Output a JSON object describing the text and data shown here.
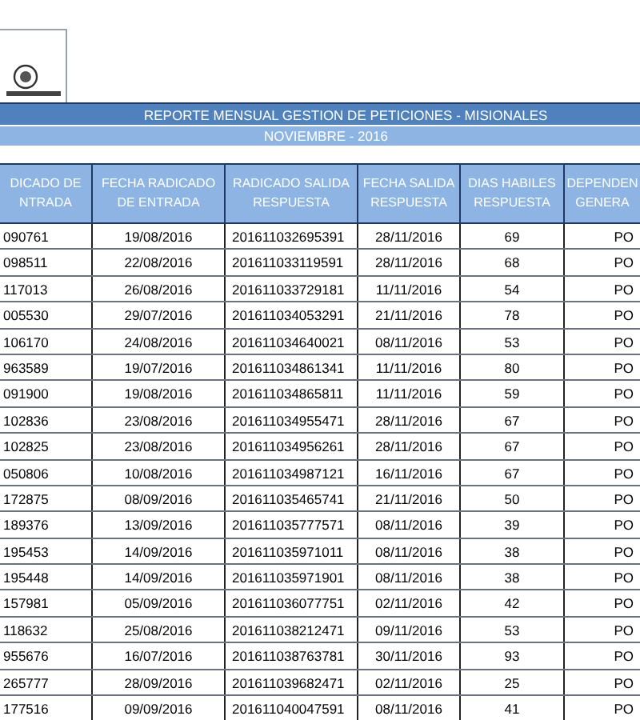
{
  "report": {
    "title": "REPORTE MENSUAL GESTION DE PETICIONES - MISIONALES",
    "period": "NOVIEMBRE - 2016"
  },
  "table": {
    "columns": [
      "DICADO DE NTRADA",
      "FECHA RADICADO DE ENTRADA",
      "RADICADO SALIDA RESPUESTA",
      "FECHA SALIDA RESPUESTA",
      "DIAS HABILES RESPUESTA",
      "DEPENDEN GENERA"
    ],
    "rows": [
      [
        "090761",
        "19/08/2016",
        "201611032695391",
        "28/11/2016",
        "69",
        "PO"
      ],
      [
        "098511",
        "22/08/2016",
        "201611033119591",
        "28/11/2016",
        "68",
        "PO"
      ],
      [
        "117013",
        "26/08/2016",
        "201611033729181",
        "11/11/2016",
        "54",
        "PO"
      ],
      [
        "005530",
        "29/07/2016",
        "201611034053291",
        "21/11/2016",
        "78",
        "PO"
      ],
      [
        "106170",
        "24/08/2016",
        "201611034640021",
        "08/11/2016",
        "53",
        "PO"
      ],
      [
        "963589",
        "19/07/2016",
        "201611034861341",
        "11/11/2016",
        "80",
        "PO"
      ],
      [
        "091900",
        "19/08/2016",
        "201611034865811",
        "11/11/2016",
        "59",
        "PO"
      ],
      [
        "102836",
        "23/08/2016",
        "201611034955471",
        "28/11/2016",
        "67",
        "PO"
      ],
      [
        "102825",
        "23/08/2016",
        "201611034956261",
        "28/11/2016",
        "67",
        "PO"
      ],
      [
        "050806",
        "10/08/2016",
        "201611034987121",
        "16/11/2016",
        "67",
        "PO"
      ],
      [
        "172875",
        "08/09/2016",
        "201611035465741",
        "21/11/2016",
        "50",
        "PO"
      ],
      [
        "189376",
        "13/09/2016",
        "201611035777571",
        "08/11/2016",
        "39",
        "PO"
      ],
      [
        "195453",
        "14/09/2016",
        "201611035971011",
        "08/11/2016",
        "38",
        "PO"
      ],
      [
        "195448",
        "14/09/2016",
        "201611035971901",
        "08/11/2016",
        "38",
        "PO"
      ],
      [
        "157981",
        "05/09/2016",
        "201611036077751",
        "02/11/2016",
        "42",
        "PO"
      ],
      [
        "118632",
        "25/08/2016",
        "201611038212471",
        "09/11/2016",
        "53",
        "PO"
      ],
      [
        "955676",
        "16/07/2016",
        "201611038763781",
        "30/11/2016",
        "93",
        "PO"
      ],
      [
        "265777",
        "28/09/2016",
        "201611039682471",
        "02/11/2016",
        "25",
        "PO"
      ],
      [
        "177516",
        "09/09/2016",
        "201611040047591",
        "08/11/2016",
        "41",
        "PO"
      ]
    ]
  }
}
